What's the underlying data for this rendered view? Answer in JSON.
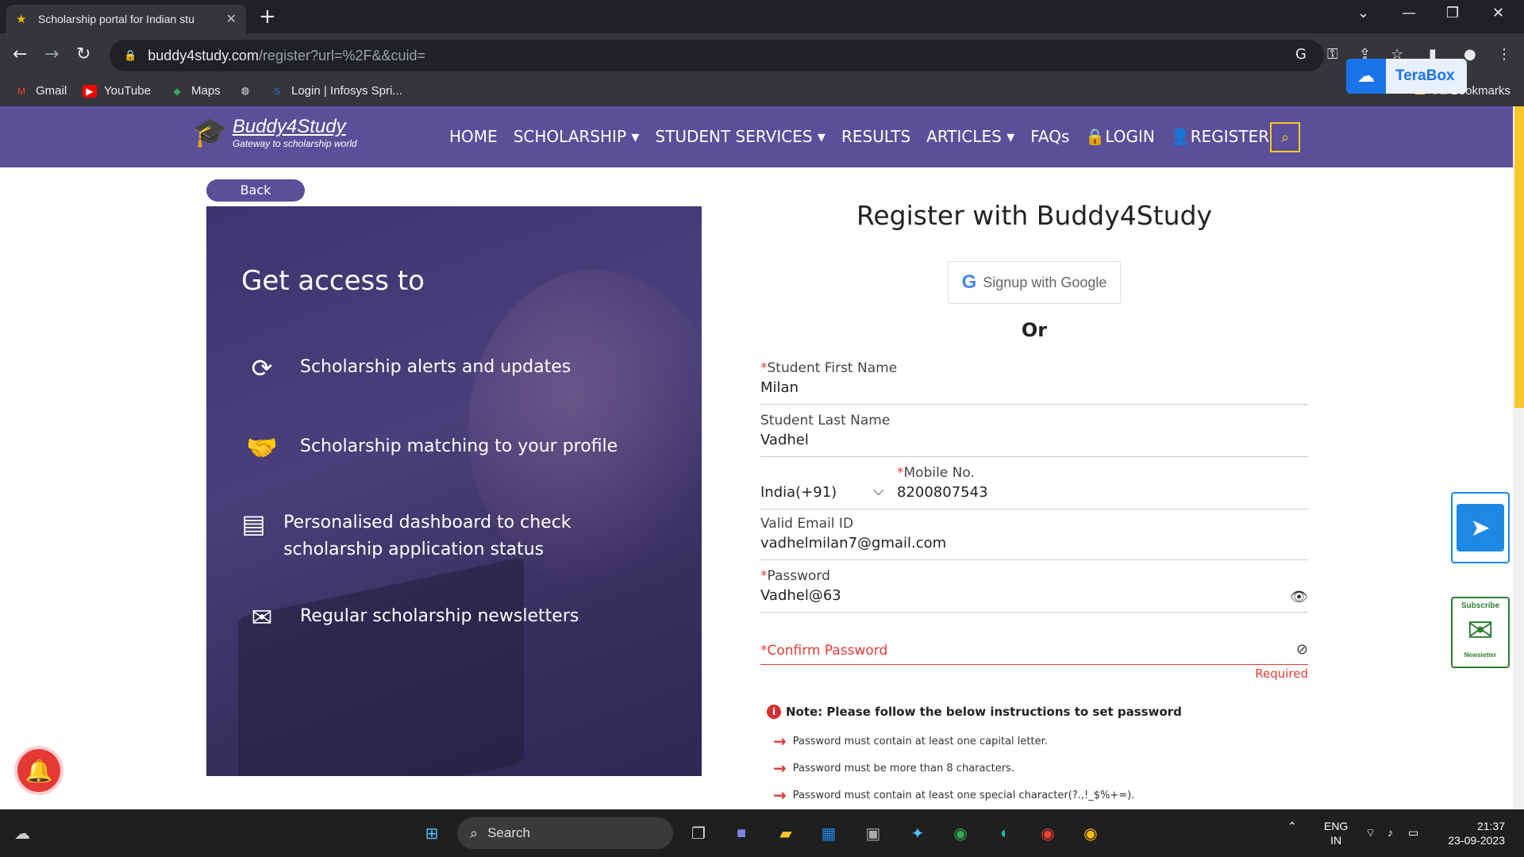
{
  "browser": {
    "tab_title": "Scholarship portal for Indian stu",
    "url_domain": "buddy4study.com",
    "url_path": "/register?url=%2F&&cuid=",
    "bookmarks": [
      "Gmail",
      "YouTube",
      "Maps",
      "Login | Infosys Spri...",
      "All Bookmarks"
    ],
    "extension_label": "TeraBox"
  },
  "site": {
    "brand": "Buddy4Study",
    "tagline": "Gateway to scholarship world",
    "nav": [
      "HOME",
      "SCHOLARSHIP",
      "STUDENT SERVICES",
      "RESULTS",
      "ARTICLES",
      "FAQs",
      "LOGIN",
      "REGISTER"
    ]
  },
  "left_panel": {
    "back_label": "Back",
    "heading": "Get access to",
    "features": [
      {
        "icon": "refresh-icon",
        "text": "Scholarship alerts and updates"
      },
      {
        "icon": "handshake-icon",
        "text": "Scholarship matching to your profile"
      },
      {
        "icon": "dashboard-icon",
        "text": "Personalised dashboard to check scholarship application status"
      },
      {
        "icon": "newsletter-icon",
        "text": "Regular scholarship newsletters"
      }
    ]
  },
  "form": {
    "title": "Register with Buddy4Study",
    "google_label": "Signup with Google",
    "or_label": "Or",
    "first_name": {
      "label": "Student First Name",
      "value": "Milan",
      "required": "*"
    },
    "last_name": {
      "label": "Student Last Name",
      "value": "Vadhel"
    },
    "country_code": "India(+91)",
    "mobile": {
      "label": "Mobile No.",
      "value": "8200807543",
      "required": "*"
    },
    "email": {
      "label": "Valid Email ID",
      "value": "vadhelmilan7@gmail.com"
    },
    "password": {
      "label": "Password",
      "value": "Vadhel@63",
      "required": "*"
    },
    "confirm_password": {
      "label": "Confirm Password",
      "value": "",
      "required": "*",
      "error": "Required"
    },
    "note": "Note: Please follow the below instructions to set password",
    "rules": [
      "Password must contain at least one capital letter.",
      "Password must be more than 8 characters.",
      "Password must contain at least one special character(?.,!_$%+=)."
    ]
  },
  "widgets": {
    "subscribe_top": "Subscribe",
    "subscribe_bottom": "Newsletter"
  },
  "taskbar": {
    "search_placeholder": "Search",
    "lang_top": "ENG",
    "lang_bottom": "IN",
    "time": "21:37",
    "date": "23-09-2023"
  },
  "colors": {
    "brand_purple": "#5b4f9a",
    "accent_yellow": "#f7c72b",
    "error_red": "#e53935"
  }
}
